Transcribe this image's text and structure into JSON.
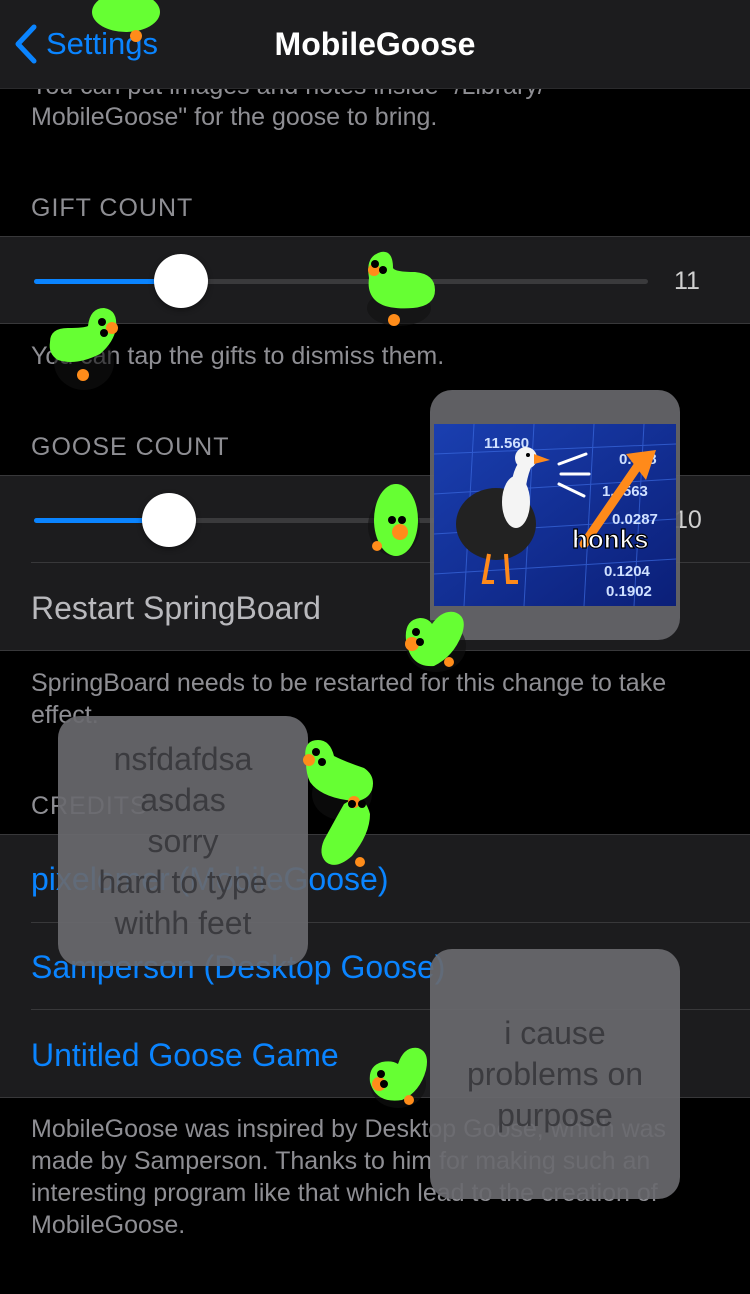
{
  "navbar": {
    "back_label": "Settings",
    "title": "MobileGoose"
  },
  "intro_footer": {
    "cut_line": "You can put images and notes inside \"/Library/",
    "line2": "MobileGoose\" for the goose to bring."
  },
  "gift_count": {
    "header": "GIFT COUNT",
    "value": "11",
    "fraction": 0.24,
    "footer": "You can tap the gifts to dismiss them."
  },
  "goose_count": {
    "header": "GOOSE COUNT",
    "value": "10",
    "fraction": 0.22
  },
  "restart": {
    "label": "Restart SpringBoard",
    "footer": "SpringBoard needs to be restarted for this change to take effect."
  },
  "credits": {
    "header": "CREDITS",
    "links": [
      {
        "label": "pixelomer (MobileGoose)"
      },
      {
        "label": "Samperson (Desktop Goose)"
      },
      {
        "label": "Untitled Goose Game"
      }
    ],
    "footer": "MobileGoose was inspired by Desktop Goose, which was made by Samperson. Thanks to him for making such an interesting program like that which lead to the creation of MobileGoose."
  },
  "notes": {
    "note1": [
      "nsfdafdsa",
      "asdas",
      "sorry",
      "hard to type",
      "withh feet"
    ],
    "note2": [
      "i cause",
      "problems on",
      "purpose"
    ]
  },
  "meme_image": {
    "caption": "honks",
    "tickers": [
      "11.560",
      "0.468",
      "1.4563",
      "0.0287",
      "0.1204",
      "0.1902"
    ]
  },
  "colors": {
    "accent": "#0a84ff",
    "goose": "#66ff33",
    "goose_beak": "#ff8c1a",
    "background": "#000000",
    "cell": "#1c1c1e"
  }
}
